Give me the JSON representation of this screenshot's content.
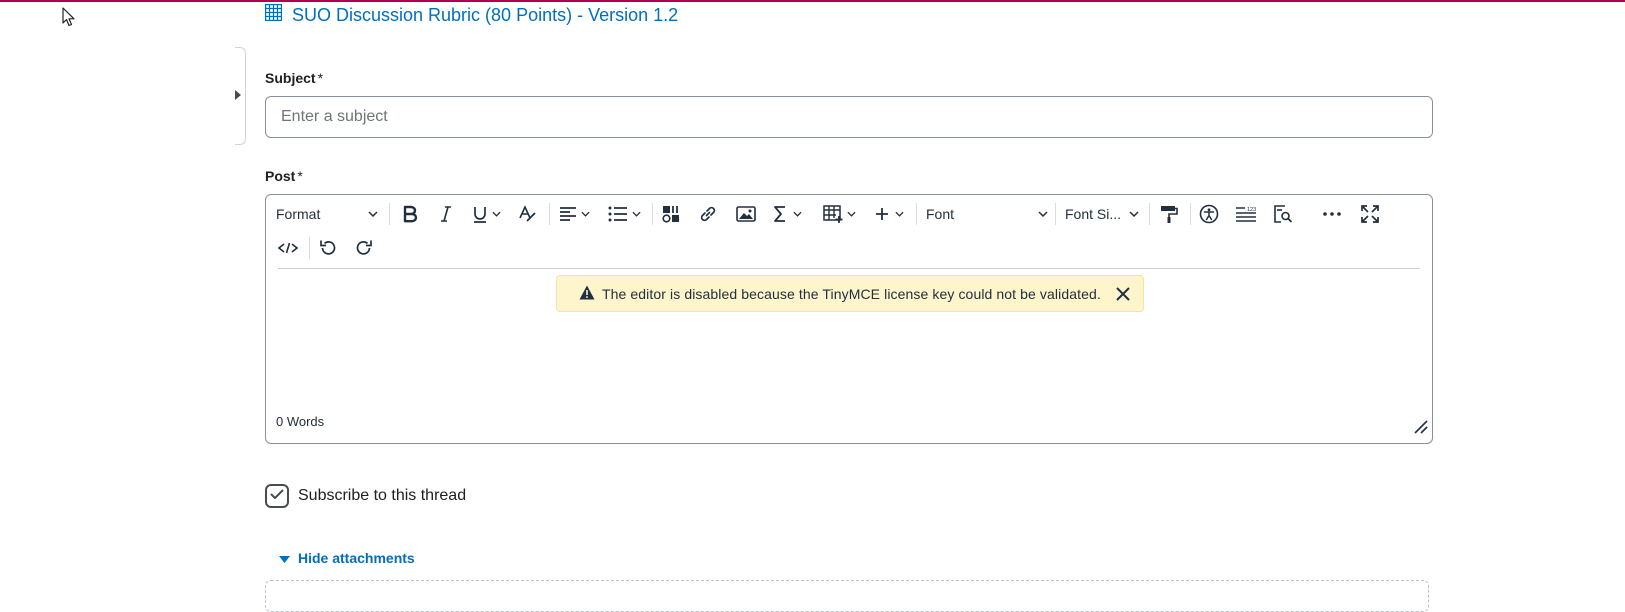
{
  "rubric": {
    "link_text": "SUO Discussion Rubric (80 Points) - Version 1.2",
    "icon": "grid-icon"
  },
  "subject": {
    "label": "Subject",
    "required_marker": "*",
    "placeholder": "Enter a subject",
    "value": ""
  },
  "post": {
    "label": "Post",
    "required_marker": "*",
    "toolbar": {
      "format_label": "Format",
      "font_label": "Font",
      "font_size_label": "Font Si..."
    },
    "notice_text": "The editor is disabled because the TinyMCE license key could not be validated.",
    "word_count": "0 Words"
  },
  "subscribe": {
    "label": "Subscribe to this thread",
    "checked": true
  },
  "attachments": {
    "toggle_label": "Hide attachments",
    "expanded": true
  },
  "colors": {
    "link": "#006fbf",
    "top_border": "#b1004f",
    "notice_bg": "#fff5cc"
  }
}
